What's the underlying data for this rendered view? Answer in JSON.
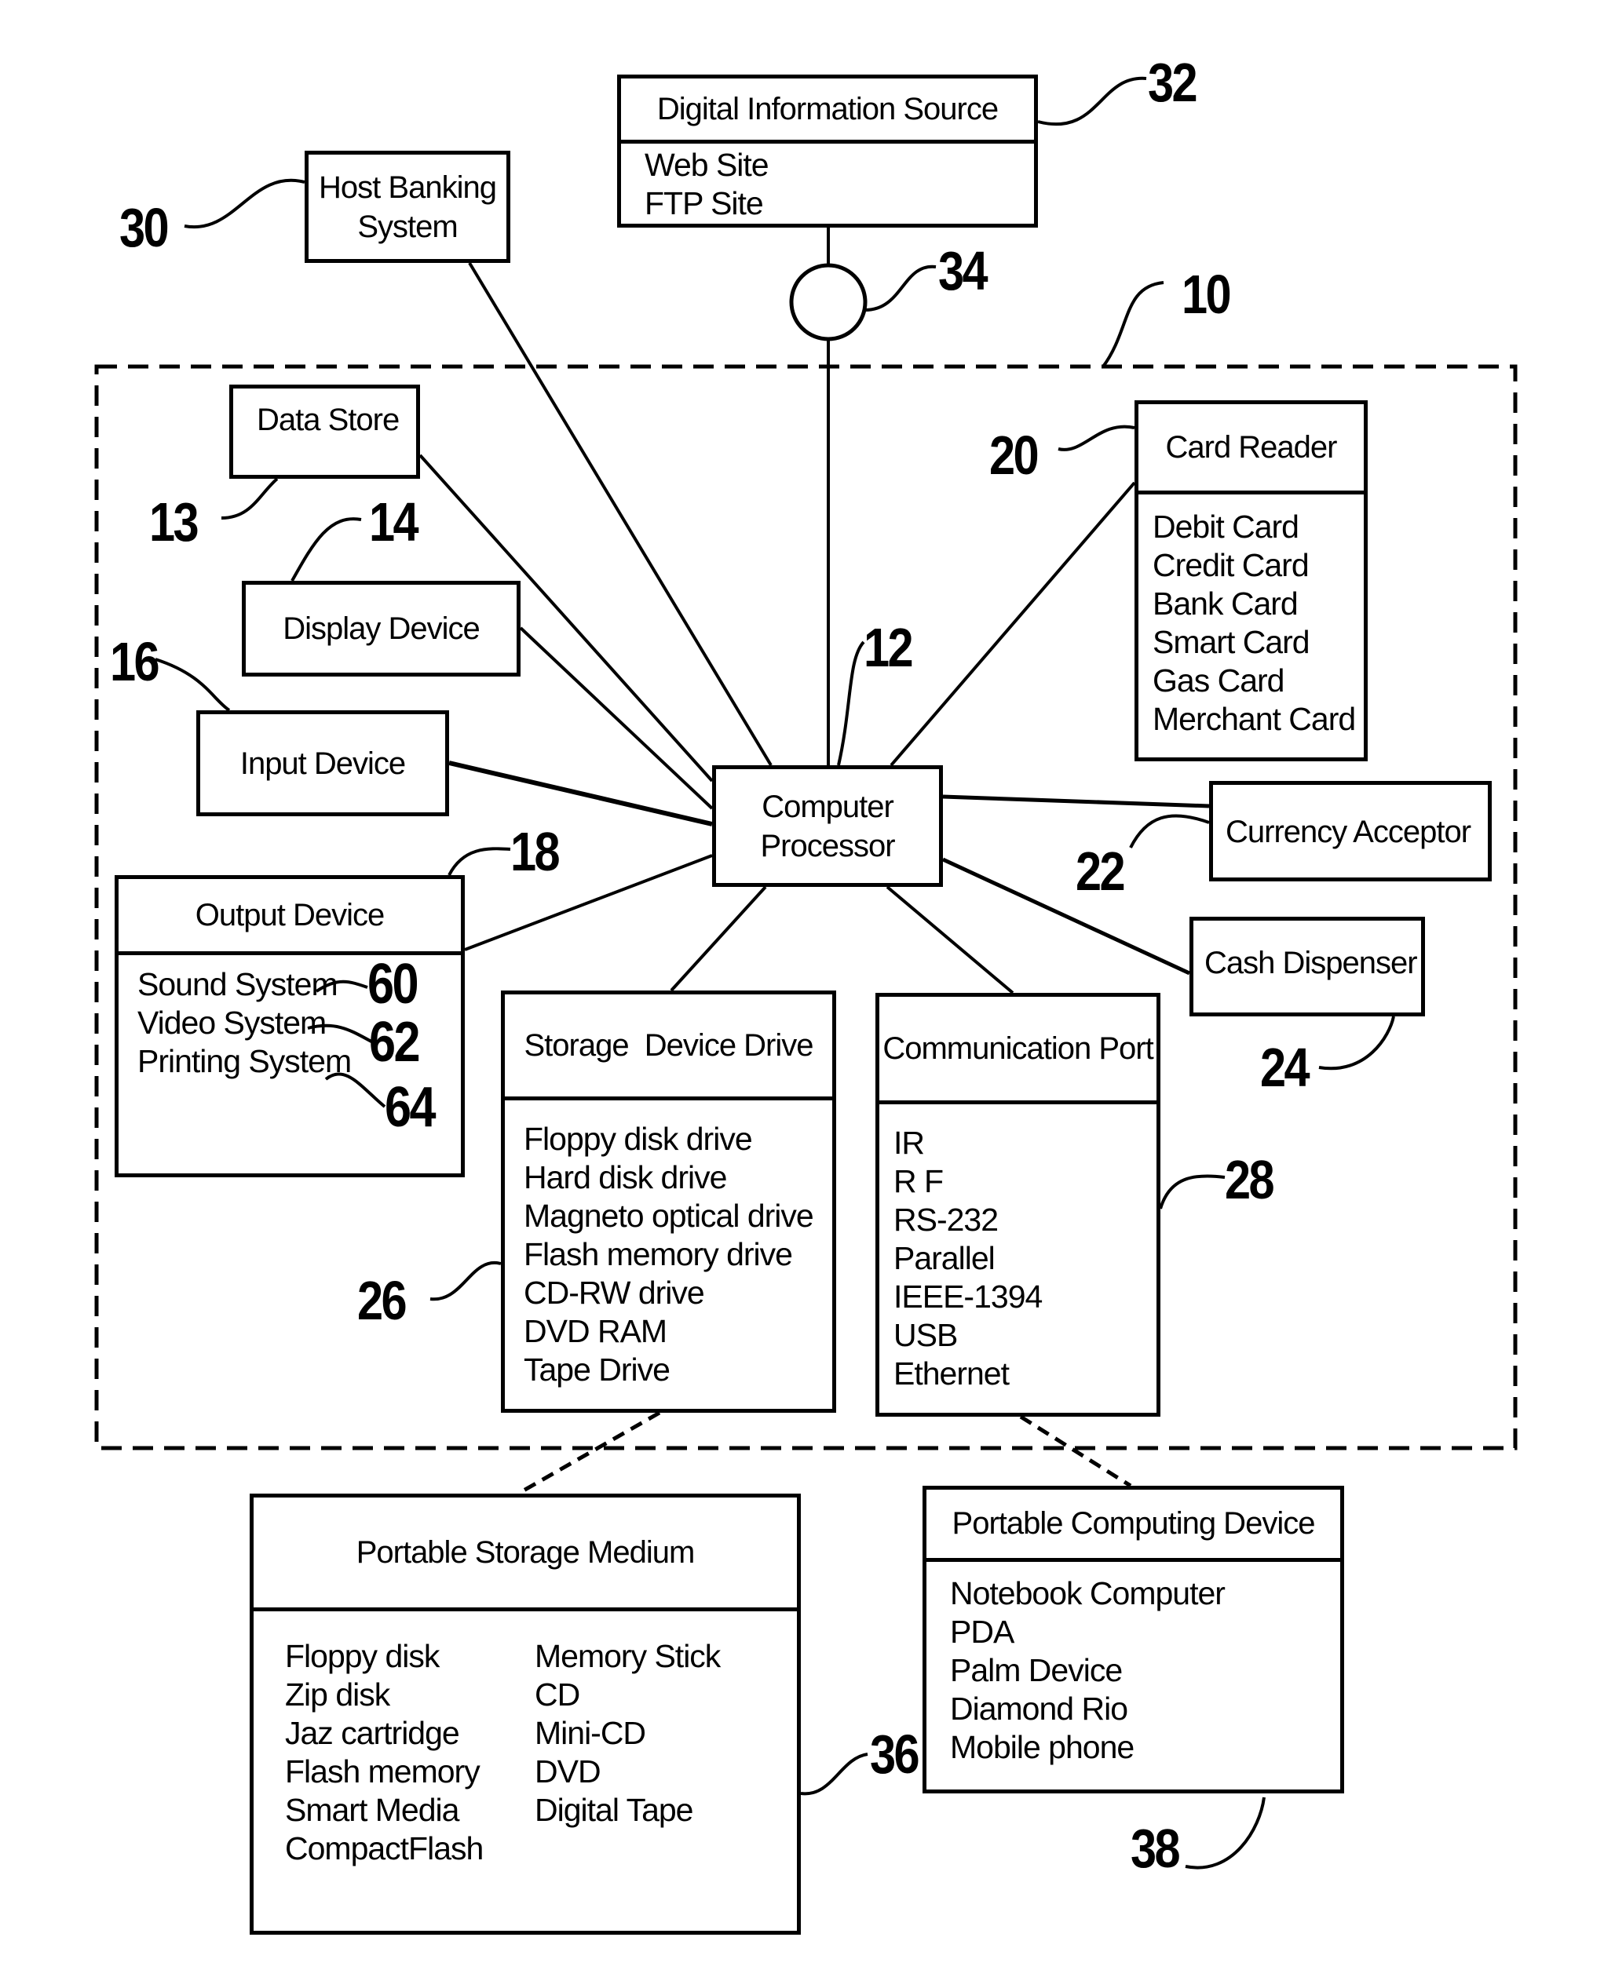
{
  "diagram": {
    "system_ref": "10",
    "digital_source": {
      "ref": "32",
      "title": "Digital Information Source",
      "items": [
        "Web Site",
        "FTP Site"
      ]
    },
    "network_node": {
      "ref": "34"
    },
    "host_banking": {
      "ref": "30",
      "line1": "Host Banking",
      "line2": "System"
    },
    "data_store": {
      "ref": "13",
      "label": "Data Store"
    },
    "display_device": {
      "ref": "14",
      "label": "Display Device"
    },
    "input_device": {
      "ref": "16",
      "label": "Input Device"
    },
    "output_device": {
      "ref": "18",
      "title": "Output Device",
      "items": [
        {
          "label": "Sound System",
          "ref": "60"
        },
        {
          "label": "Video System",
          "ref": "62"
        },
        {
          "label": "Printing System",
          "ref": "64"
        }
      ]
    },
    "computer_processor": {
      "ref": "12",
      "line1": "Computer",
      "line2": "Processor"
    },
    "card_reader": {
      "ref": "20",
      "title": "Card Reader",
      "items": [
        "Debit Card",
        "Credit Card",
        "Bank Card",
        "Smart Card",
        "Gas Card",
        "Merchant Card"
      ]
    },
    "currency_acceptor": {
      "ref": "22",
      "label": "Currency Acceptor"
    },
    "cash_dispenser": {
      "ref": "24",
      "label": "Cash Dispenser"
    },
    "storage_drive": {
      "ref": "26",
      "title": "Storage  Device Drive",
      "items": [
        "Floppy disk drive",
        "Hard disk drive",
        "Magneto optical drive",
        "Flash memory drive",
        "CD-RW drive",
        "DVD RAM",
        "Tape Drive"
      ]
    },
    "comm_port": {
      "ref": "28",
      "title": "Communication Port",
      "items": [
        "IR",
        "R F",
        "RS-232",
        "Parallel",
        "IEEE-1394",
        "USB",
        "Ethernet"
      ]
    },
    "portable_storage": {
      "ref": "36",
      "title": "Portable Storage Medium",
      "col1": [
        "Floppy disk",
        "Zip disk",
        "Jaz cartridge",
        "Flash memory",
        "Smart Media",
        "CompactFlash"
      ],
      "col2": [
        "Memory Stick",
        "CD",
        "Mini-CD",
        "DVD",
        "Digital Tape"
      ]
    },
    "portable_computing": {
      "ref": "38",
      "title": "Portable Computing Device",
      "items": [
        "Notebook Computer",
        "PDA",
        "Palm Device",
        "Diamond Rio",
        "Mobile phone"
      ]
    }
  }
}
